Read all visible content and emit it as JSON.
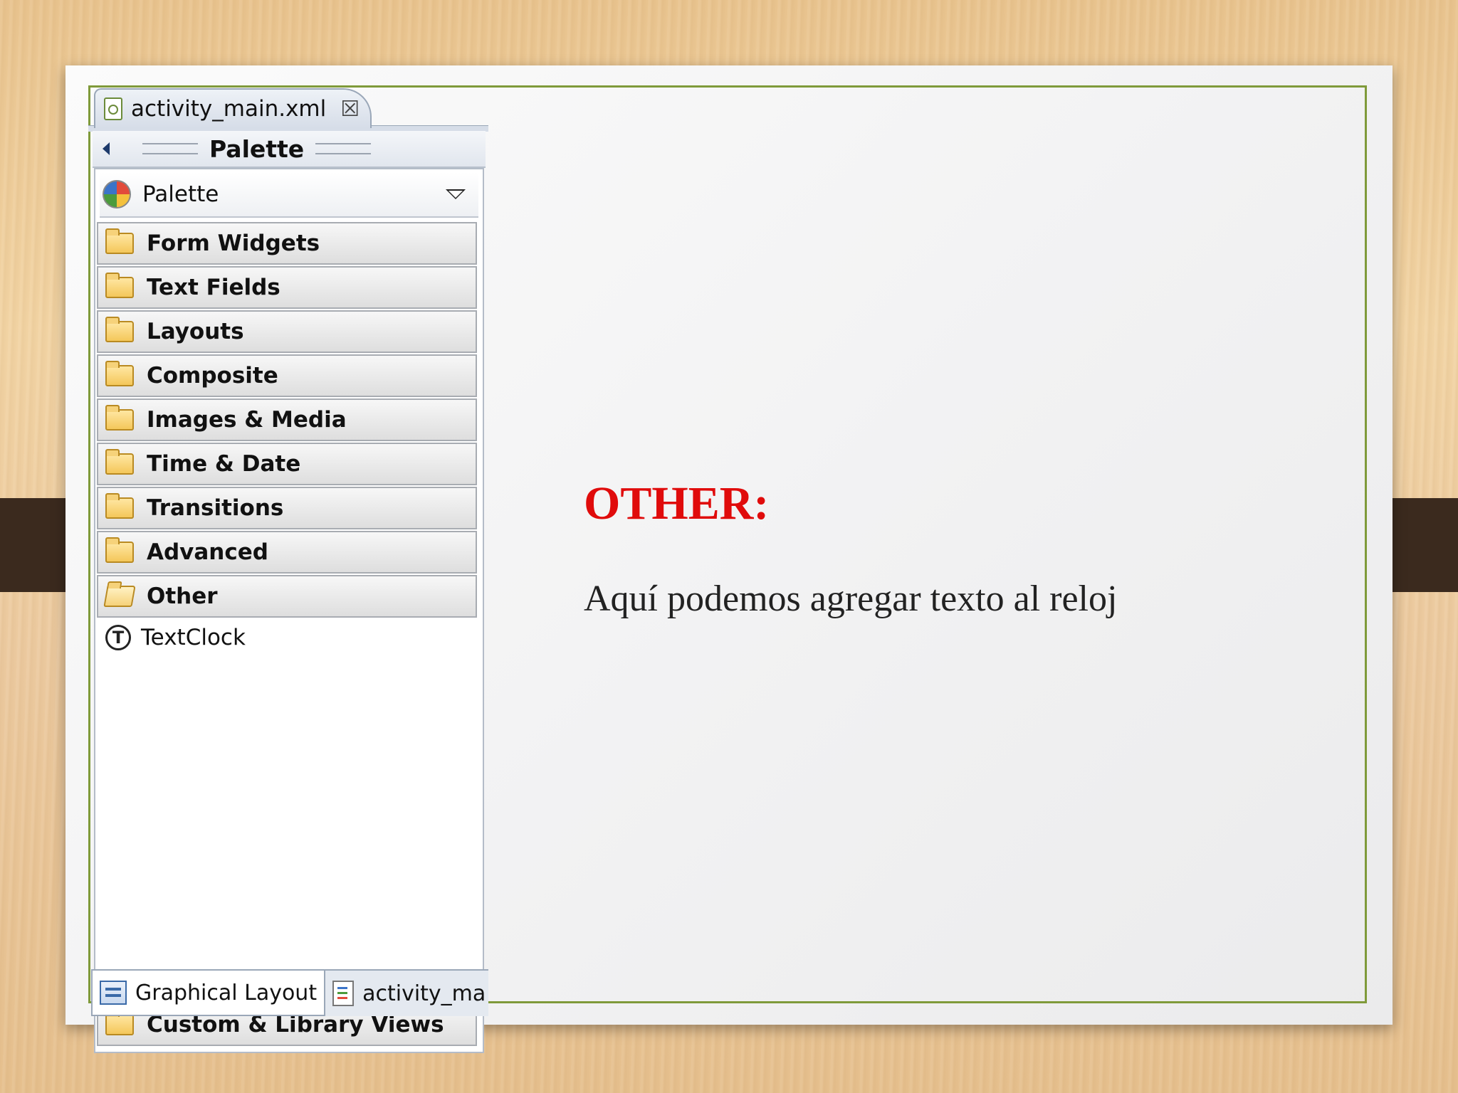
{
  "editor_tab": {
    "label": "activity_main.xml",
    "close_icon": "close-x-icon"
  },
  "palette_header": {
    "title": "Palette"
  },
  "palette_select": {
    "label": "Palette"
  },
  "drawers": [
    {
      "label": "Form Widgets",
      "open": false
    },
    {
      "label": "Text Fields",
      "open": false
    },
    {
      "label": "Layouts",
      "open": false
    },
    {
      "label": "Composite",
      "open": false
    },
    {
      "label": "Images & Media",
      "open": false
    },
    {
      "label": "Time & Date",
      "open": false
    },
    {
      "label": "Transitions",
      "open": false
    },
    {
      "label": "Advanced",
      "open": false
    },
    {
      "label": "Other",
      "open": true
    }
  ],
  "other_items": [
    {
      "label": "TextClock",
      "icon_glyph": "T"
    }
  ],
  "custom_drawer": {
    "label": "Custom & Library Views"
  },
  "bottom_tabs": [
    {
      "label": "Graphical Layout",
      "active": true
    },
    {
      "label": "activity_ma",
      "active": false
    }
  ],
  "slide": {
    "title": "OTHER:",
    "body": "Aquí podemos agregar texto al reloj",
    "title_color": "#e00b0b",
    "frame_color": "#7f9a3a"
  }
}
